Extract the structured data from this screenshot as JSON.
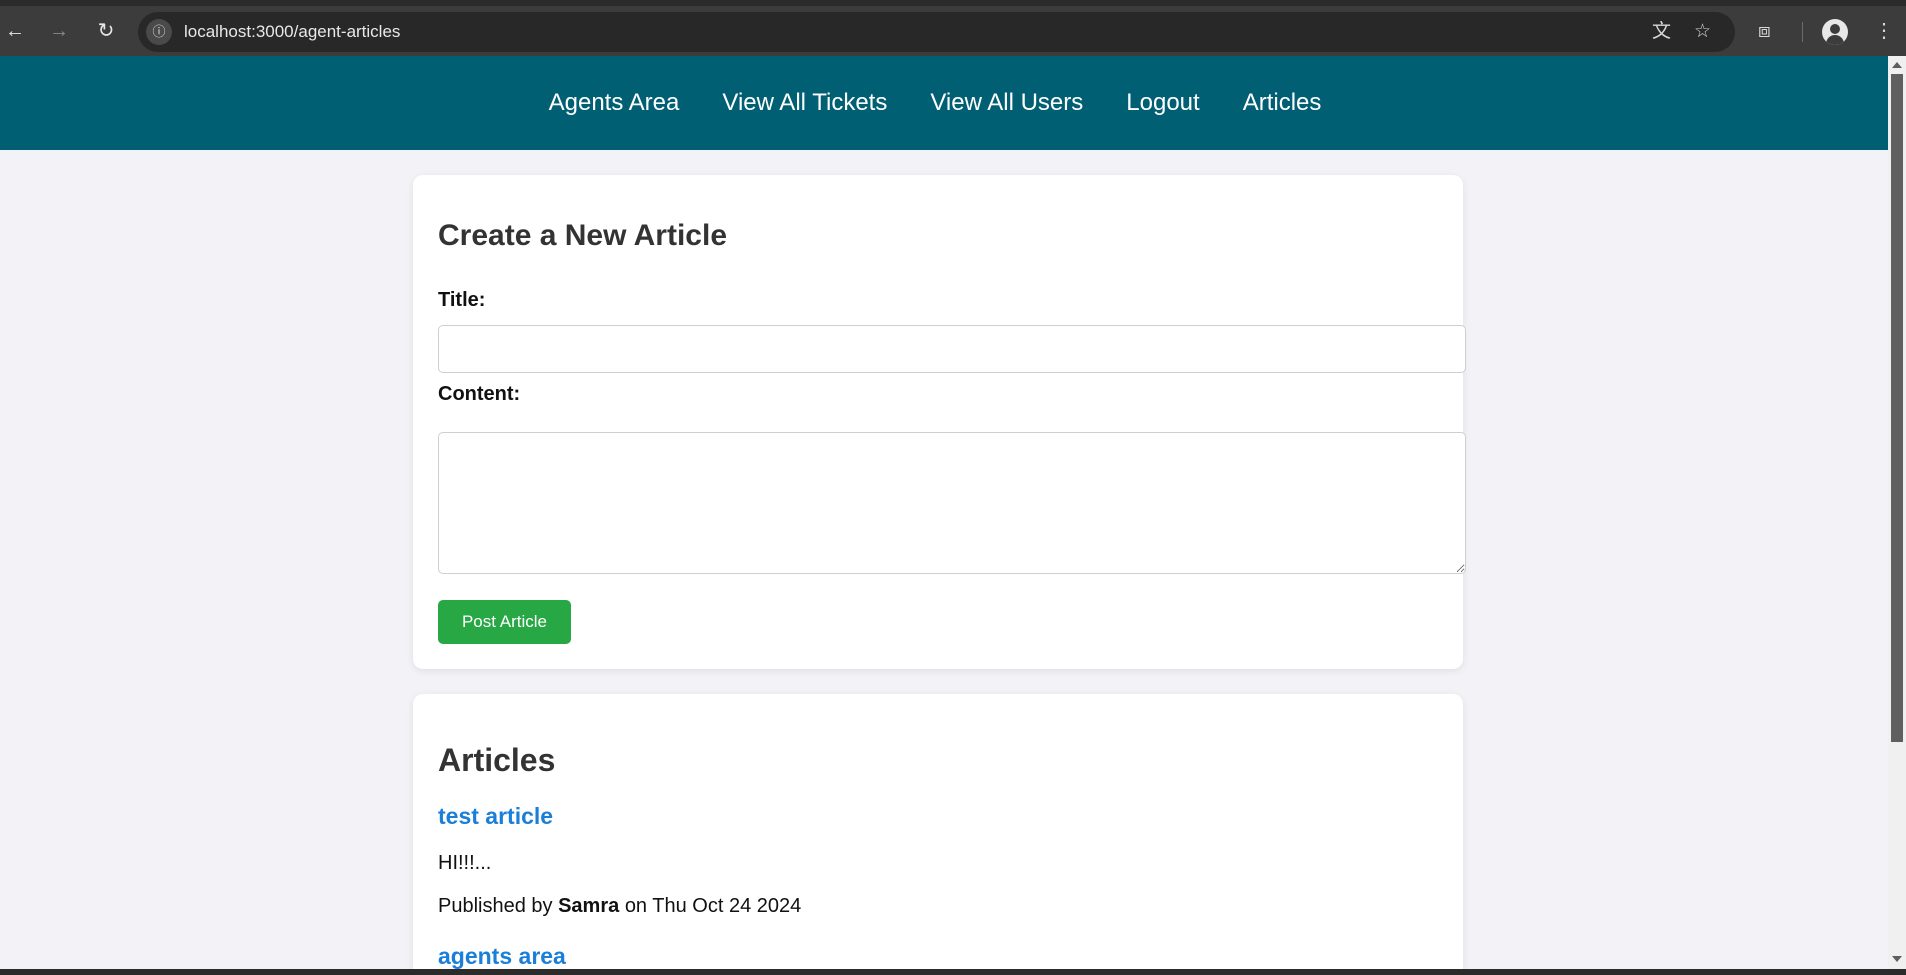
{
  "browser": {
    "url": "localhost:3000/agent-articles",
    "icons": {
      "back": "arrow-left-icon",
      "forward": "arrow-right-icon",
      "reload": "reload-icon",
      "site_info": "info-icon",
      "translate": "translate-icon",
      "bookmark": "star-icon",
      "extensions": "puzzle-icon",
      "profile": "account-icon",
      "menu": "kebab-menu-icon"
    }
  },
  "nav": {
    "items": [
      {
        "label": "Agents Area"
      },
      {
        "label": "View All Tickets"
      },
      {
        "label": "View All Users"
      },
      {
        "label": "Logout"
      },
      {
        "label": "Articles"
      }
    ]
  },
  "create_form": {
    "heading": "Create a New Article",
    "title_label": "Title:",
    "title_value": "",
    "content_label": "Content:",
    "content_value": "",
    "submit_label": "Post Article"
  },
  "articles": {
    "heading": "Articles",
    "items": [
      {
        "title": "test article",
        "excerpt": "HI!!!...",
        "published_prefix": "Published by",
        "author": "Samra",
        "date_prefix": "on",
        "date": "Thu Oct 24 2024"
      },
      {
        "title": "agents area"
      }
    ]
  },
  "colors": {
    "nav_background": "#005f73",
    "page_background": "#f2f2f7",
    "link": "#1a7fd8",
    "primary_button": "#28a745"
  }
}
